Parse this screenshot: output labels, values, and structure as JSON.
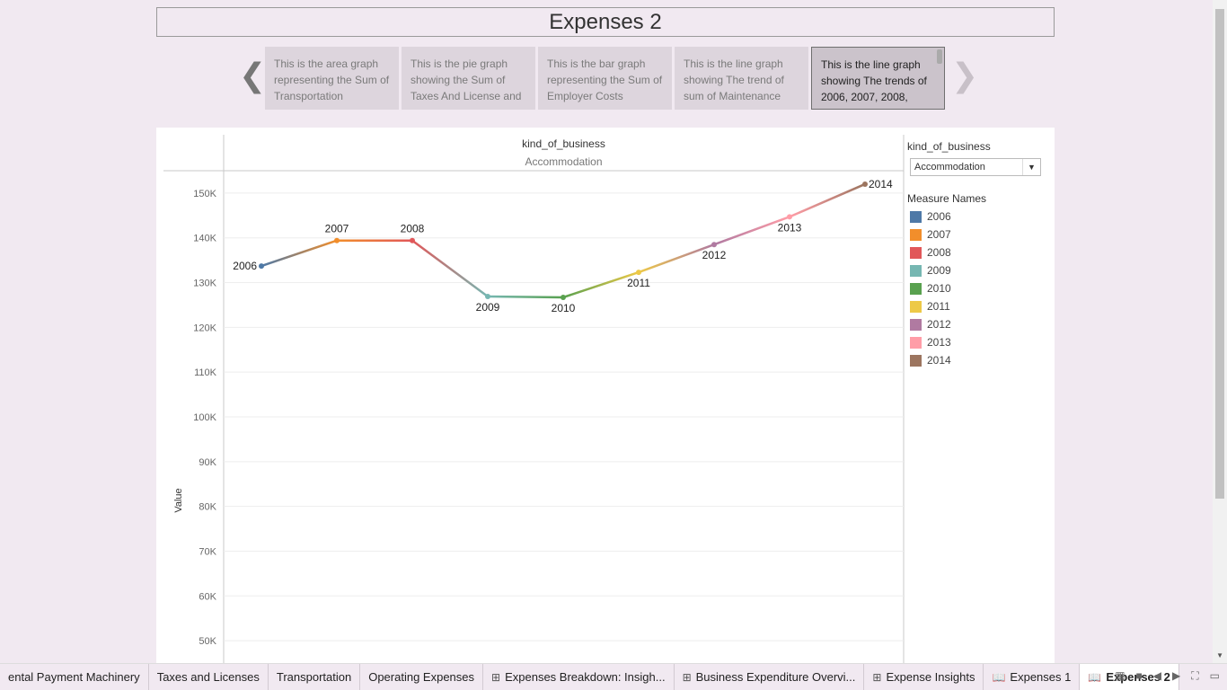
{
  "story": {
    "title": "Expenses 2",
    "points": [
      {
        "text": "This is the area graph representing the Sum of Transportation"
      },
      {
        "text": "This is the pie graph showing the Sum of Taxes And License and"
      },
      {
        "text": "This is the bar graph representing the Sum of Employer Costs"
      },
      {
        "text": "This is the line graph showing The trend of sum of Maintenance"
      },
      {
        "text": "This is the line graph showing The trends of 2006, 2007, 2008,"
      }
    ],
    "prev_arrow": "❮",
    "next_arrow": "❯"
  },
  "chart_data": {
    "type": "line",
    "column_header_title": "kind_of_business",
    "column_header_value": "Accommodation",
    "ylabel": "Value",
    "ylim": [
      45000,
      155000
    ],
    "yticks": [
      50000,
      60000,
      70000,
      80000,
      90000,
      100000,
      110000,
      120000,
      130000,
      140000,
      150000
    ],
    "ytick_labels": [
      "50K",
      "60K",
      "70K",
      "80K",
      "90K",
      "100K",
      "110K",
      "120K",
      "130K",
      "140K",
      "150K"
    ],
    "categories": [
      "2006",
      "2007",
      "2008",
      "2009",
      "2010",
      "2011",
      "2012",
      "2013",
      "2014"
    ],
    "values": [
      133700,
      139400,
      139400,
      126900,
      126700,
      132300,
      138500,
      144700,
      152000
    ],
    "colors": [
      "#4e79a7",
      "#f28e2b",
      "#e15759",
      "#76b7b2",
      "#59a14f",
      "#edc948",
      "#b07aa1",
      "#ff9da7",
      "#9c755f"
    ],
    "label_positions": [
      "left",
      "above",
      "above",
      "below",
      "below",
      "below",
      "below",
      "below",
      "right"
    ]
  },
  "legend": {
    "filter_title": "kind_of_business",
    "filter_value": "Accommodation",
    "measure_title": "Measure Names",
    "items": [
      "2006",
      "2007",
      "2008",
      "2009",
      "2010",
      "2011",
      "2012",
      "2013",
      "2014"
    ]
  },
  "tabs": [
    {
      "label": "ental Payment Machinery",
      "icon": ""
    },
    {
      "label": "Taxes and Licenses",
      "icon": ""
    },
    {
      "label": "Transportation",
      "icon": ""
    },
    {
      "label": "Operating Expenses",
      "icon": ""
    },
    {
      "label": "Expenses Breakdown: Insigh...",
      "icon": "⊞"
    },
    {
      "label": "Business Expenditure Overvi...",
      "icon": "⊞"
    },
    {
      "label": "Expense Insights",
      "icon": "⊞"
    },
    {
      "label": "Expenses 1",
      "icon": "📖"
    },
    {
      "label": "Expenses 2",
      "icon": "📖"
    }
  ],
  "active_tab": 8
}
